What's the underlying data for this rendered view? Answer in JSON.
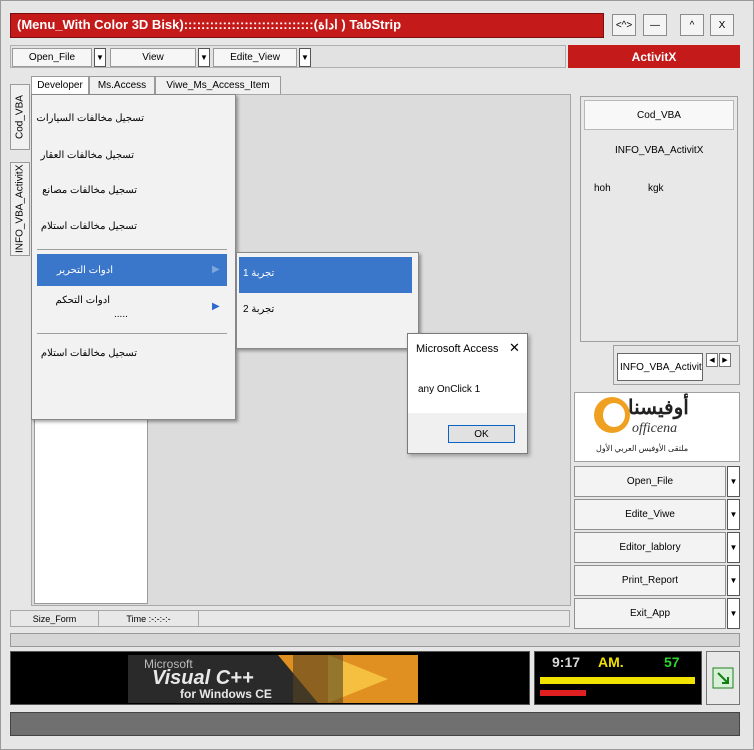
{
  "window": {
    "title": "(Menu_With Color 3D Bisk)::::::::::::::::::::::::::::::(اداة ) TabStrip",
    "buttons": [
      "<^>",
      "—",
      "^",
      "X"
    ]
  },
  "toolbar": {
    "open_file": "Open_File",
    "view": "View",
    "edite_view": "Edite_View",
    "activitx": "ActivitX"
  },
  "tabs": [
    "Developer",
    "Ms.Access",
    "Viwe_Ms_Access_Item"
  ],
  "vertical_tabs": [
    "Cod_VBA",
    "INFO_VBA_ActivitX"
  ],
  "menu": {
    "items": [
      "تسجيل مخالفات السيارات",
      "تسجيل مخالفات العقار",
      "تسجيل مخالفات مصانع",
      "تسجيل مخالفات استلام",
      "ادوات التحرير",
      "ادوات التحكم",
      "تسجيل مخالفات استلام"
    ],
    "dots": ".....",
    "submenu": [
      "تجربة 1",
      "تجربة 2"
    ]
  },
  "dialog": {
    "title": "Microsoft Access",
    "message": "any OnClick 1",
    "ok": "OK"
  },
  "right_panel": {
    "cod_vba": "Cod_VBA",
    "info": "INFO_VBA_ActivitX",
    "text1": "hoh",
    "text2": "kgk",
    "info_button": "INFO_VBA_ActivitX",
    "logo_ar": "أوفيسنا",
    "logo_en": "officena",
    "logo_tagline": "ملتقى الأوفيس العربي الأول"
  },
  "actions": [
    "Open_File",
    "Edite_Viwe",
    "Editor_lablory",
    "Print_Report",
    "Exit_App"
  ],
  "status": {
    "size_form": "Size_Form",
    "time": "Time :-:-:-:-"
  },
  "banner": {
    "line1": "Microsoft",
    "line2": "Visual C++",
    "line3": "for Windows CE"
  },
  "clock": {
    "hour": "9:17",
    "ampm": "AM.",
    "seconds": "57"
  },
  "colors": {
    "title_red": "#c41a1a",
    "menu_blue": "#3a76c9",
    "clock_yellow": "#f2e200",
    "clock_green": "#28d828"
  }
}
